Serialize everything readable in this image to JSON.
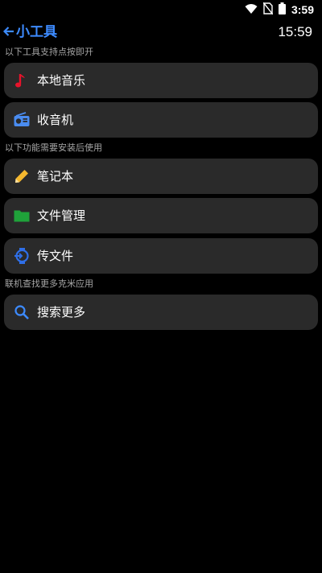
{
  "status_bar": {
    "time": "3:59",
    "icons": [
      "wifi-icon",
      "no-sim-icon",
      "battery-icon"
    ]
  },
  "header": {
    "back_icon": "arrow-left-icon",
    "title": "小工具",
    "clock": "15:59"
  },
  "sections": [
    {
      "label": "以下工具支持点按即开",
      "items": [
        {
          "label": "本地音乐",
          "icon": "music-note-icon"
        },
        {
          "label": "收音机",
          "icon": "radio-icon"
        }
      ]
    },
    {
      "label": "以下功能需要安装后使用",
      "items": [
        {
          "label": "笔记本",
          "icon": "pencil-icon"
        },
        {
          "label": "文件管理",
          "icon": "folder-icon"
        },
        {
          "label": "传文件",
          "icon": "watch-transfer-icon"
        }
      ]
    },
    {
      "label": "联机查找更多克米应用",
      "items": [
        {
          "label": "搜索更多",
          "icon": "search-icon"
        }
      ]
    }
  ],
  "colors": {
    "accent": "#3d8bff",
    "card_background": "#2a2a2a",
    "music_icon": "#e8132b",
    "radio_icon": "#4a8cf0",
    "pencil_icon": "#f5b82e",
    "folder_icon": "#1fa23a",
    "watch_icon": "#2f6fe8",
    "search_icon": "#3d8bff"
  }
}
